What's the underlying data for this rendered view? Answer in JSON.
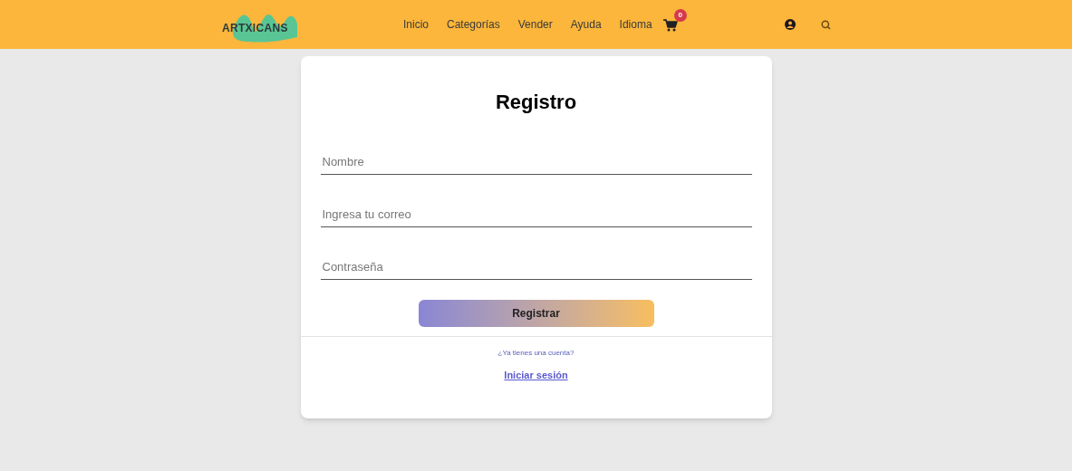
{
  "header": {
    "logo": "ARTXICANS",
    "nav": [
      "Inicio",
      "Categorías",
      "Vender",
      "Ayuda",
      "Idioma"
    ],
    "cart_count": "0"
  },
  "form": {
    "title": "Registro",
    "fields": [
      {
        "placeholder": "Nombre"
      },
      {
        "placeholder": "Ingresa tu correo"
      },
      {
        "placeholder": "Contraseña"
      }
    ],
    "submit": "Registrar",
    "prompt": "¿Ya tienes una cuenta?",
    "login_link": "Iniciar sesión"
  }
}
